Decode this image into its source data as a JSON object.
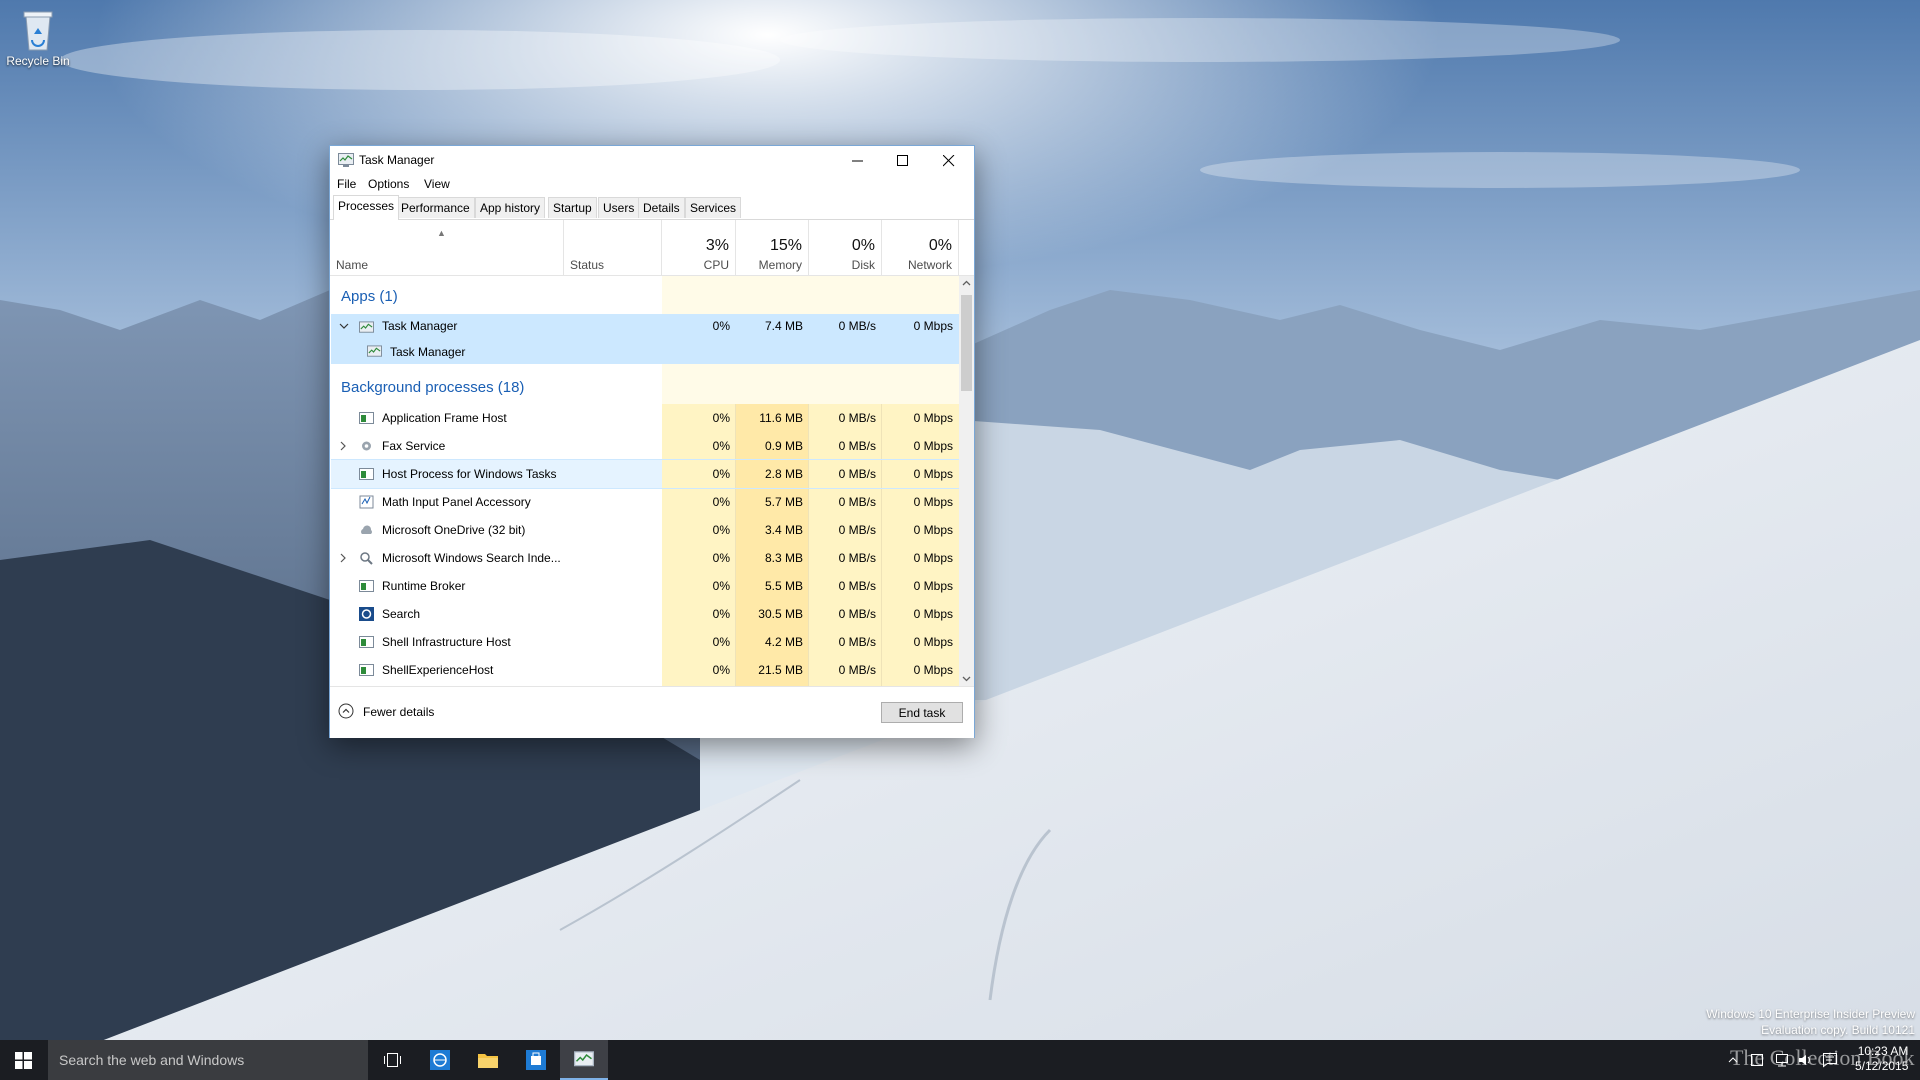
{
  "desktop": {
    "icons": [
      {
        "label": "Recycle Bin",
        "icon": "recycle-bin-icon"
      }
    ]
  },
  "window": {
    "title": "Task Manager",
    "menu": [
      "File",
      "Options",
      "View"
    ],
    "tabs": [
      "Processes",
      "Performance",
      "App history",
      "Startup",
      "Users",
      "Details",
      "Services"
    ],
    "active_tab": "Processes",
    "columns": {
      "name": "Name",
      "status": "Status",
      "cpu": {
        "pct": "3%",
        "label": "CPU"
      },
      "memory": {
        "pct": "15%",
        "label": "Memory"
      },
      "disk": {
        "pct": "0%",
        "label": "Disk"
      },
      "network": {
        "pct": "0%",
        "label": "Network"
      }
    },
    "groups": {
      "apps": {
        "title": "Apps (1)",
        "rows": [
          {
            "name": "Task Manager",
            "cpu": "0%",
            "memory": "7.4 MB",
            "disk": "0 MB/s",
            "network": "0 Mbps",
            "expanded": true,
            "icon": "task-manager-icon"
          }
        ],
        "child": {
          "name": "Task Manager",
          "icon": "task-manager-icon"
        }
      },
      "background": {
        "title": "Background processes (18)",
        "rows": [
          {
            "name": "Application Frame Host",
            "cpu": "0%",
            "memory": "11.6 MB",
            "disk": "0 MB/s",
            "network": "0 Mbps",
            "icon": "app-window-icon"
          },
          {
            "name": "Fax Service",
            "cpu": "0%",
            "memory": "0.9 MB",
            "disk": "0 MB/s",
            "network": "0 Mbps",
            "expandable": true,
            "icon": "service-gear-icon"
          },
          {
            "name": "Host Process for Windows Tasks",
            "cpu": "0%",
            "memory": "2.8 MB",
            "disk": "0 MB/s",
            "network": "0 Mbps",
            "icon": "app-window-icon",
            "hover": true
          },
          {
            "name": "Math Input Panel Accessory",
            "cpu": "0%",
            "memory": "5.7 MB",
            "disk": "0 MB/s",
            "network": "0 Mbps",
            "icon": "math-input-icon"
          },
          {
            "name": "Microsoft OneDrive (32 bit)",
            "cpu": "0%",
            "memory": "3.4 MB",
            "disk": "0 MB/s",
            "network": "0 Mbps",
            "icon": "onedrive-cloud-icon"
          },
          {
            "name": "Microsoft Windows Search Inde...",
            "cpu": "0%",
            "memory": "8.3 MB",
            "disk": "0 MB/s",
            "network": "0 Mbps",
            "expandable": true,
            "icon": "search-indexer-icon"
          },
          {
            "name": "Runtime Broker",
            "cpu": "0%",
            "memory": "5.5 MB",
            "disk": "0 MB/s",
            "network": "0 Mbps",
            "icon": "app-window-icon"
          },
          {
            "name": "Search",
            "cpu": "0%",
            "memory": "30.5 MB",
            "disk": "0 MB/s",
            "network": "0 Mbps",
            "icon": "cortana-search-icon"
          },
          {
            "name": "Shell Infrastructure Host",
            "cpu": "0%",
            "memory": "4.2 MB",
            "disk": "0 MB/s",
            "network": "0 Mbps",
            "icon": "app-window-icon"
          },
          {
            "name": "ShellExperienceHost",
            "cpu": "0%",
            "memory": "21.5 MB",
            "disk": "0 MB/s",
            "network": "0 Mbps",
            "icon": "app-window-icon"
          }
        ]
      }
    },
    "footer": {
      "fewer_details": "Fewer details",
      "end_task": "End task"
    }
  },
  "taskbar": {
    "search_placeholder": "Search the web and Windows",
    "pinned": [
      "task-view-icon",
      "internet-explorer-icon",
      "file-explorer-icon",
      "store-icon",
      "task-manager-icon"
    ],
    "clock_time": "10:23 AM",
    "clock_date": "5/12/2015"
  },
  "watermark": {
    "line1": "Windows 10 Enterprise Insider Preview",
    "line2": "Evaluation copy. Build 10121"
  },
  "brand_watermark": "The Collection Book",
  "colors": {
    "row_selected": "#cce8ff",
    "row_hover": "#e5f3ff",
    "heat_low": "#fff4c4",
    "heat_mem": "#ffe9a8",
    "group_title": "#1a5fb4",
    "taskbar": "#1b1d22"
  }
}
